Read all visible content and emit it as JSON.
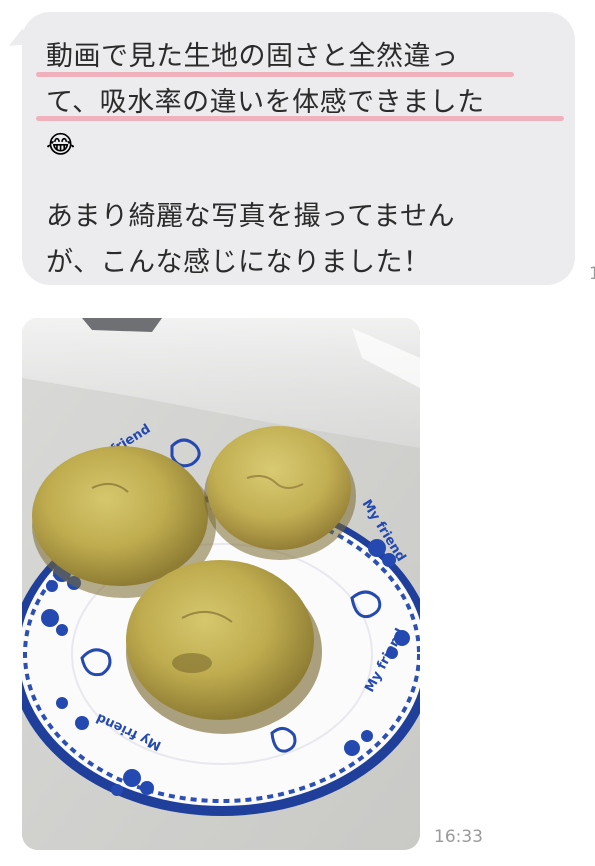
{
  "message": {
    "lines": [
      "動画で見た生地の固さと全然違っ",
      "て、吸水率の違いを体感できました",
      "あまり綺麗な写真を撮ってません",
      "が、こんな感じになりました！"
    ],
    "emoji": "😂",
    "read_count": "1"
  },
  "photo": {
    "plate_text": "My friend",
    "subject": "muffins"
  },
  "timestamp": "16:33",
  "colors": {
    "bubble": "#ececef",
    "highlight": "#f1a7b4",
    "meta_text": "#9a9a9a"
  }
}
